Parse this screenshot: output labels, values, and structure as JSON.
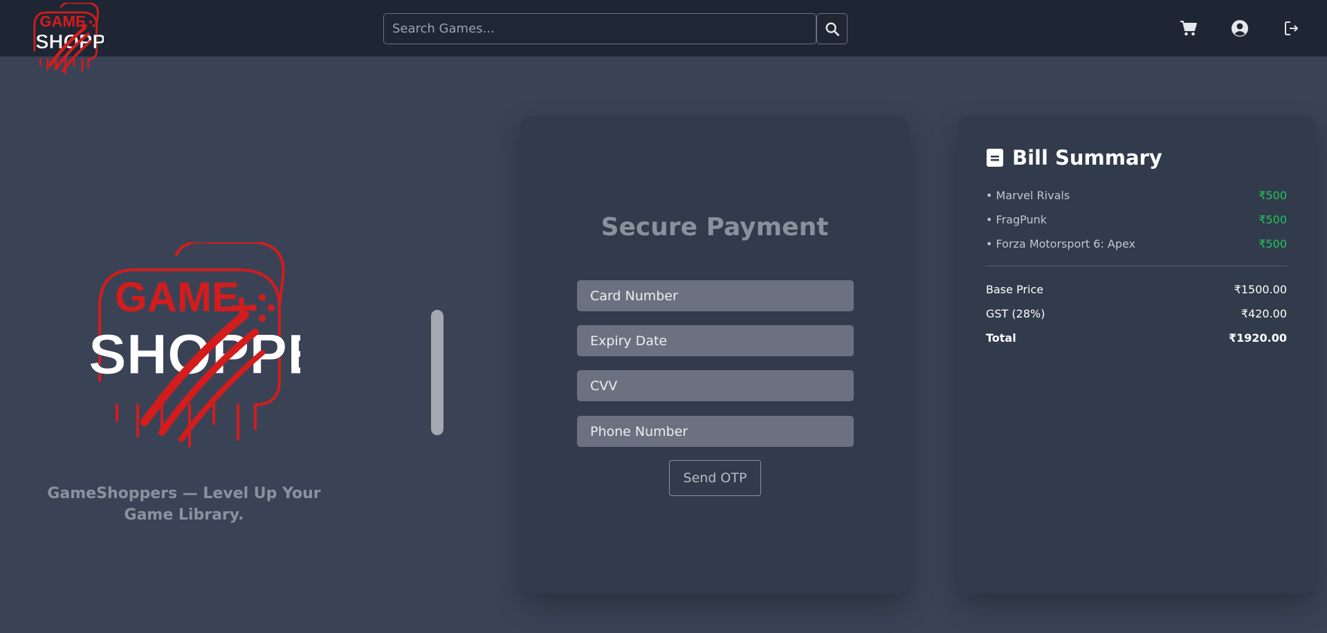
{
  "header": {
    "logo_alt": "GAME SHOPPERS",
    "search": {
      "placeholder": "Search Games..."
    },
    "icons": [
      "cart-icon",
      "user-circle-icon",
      "logout-icon"
    ]
  },
  "hero": {
    "logo_text_top": "GAME",
    "logo_text_bottom": "SHOPPERS",
    "tagline": "GameShoppers — Level Up Your Game Library."
  },
  "payment": {
    "title": "Secure Payment",
    "fields": {
      "card_number": "Card Number",
      "expiry_date": "Expiry Date",
      "cvv": "CVV",
      "phone_number": "Phone Number"
    },
    "send_otp_label": "Send OTP"
  },
  "bill": {
    "title": "Bill Summary",
    "items": [
      {
        "name": "• Marvel Rivals",
        "price": "₹500"
      },
      {
        "name": "• FragPunk",
        "price": "₹500"
      },
      {
        "name": "• Forza Motorsport 6: Apex",
        "price": "₹500"
      }
    ],
    "base_price": {
      "label": "Base Price",
      "value": "₹1500.00"
    },
    "gst": {
      "label": "GST (28%)",
      "value": "₹420.00"
    },
    "total": {
      "label": "Total",
      "value": "₹1920.00"
    }
  },
  "colors": {
    "page_bg": "#3a4356",
    "navbar_bg": "#1e2634",
    "card_bg": "#323b4b",
    "brand_red": "#d41c1c",
    "price_green": "#22c55e"
  }
}
